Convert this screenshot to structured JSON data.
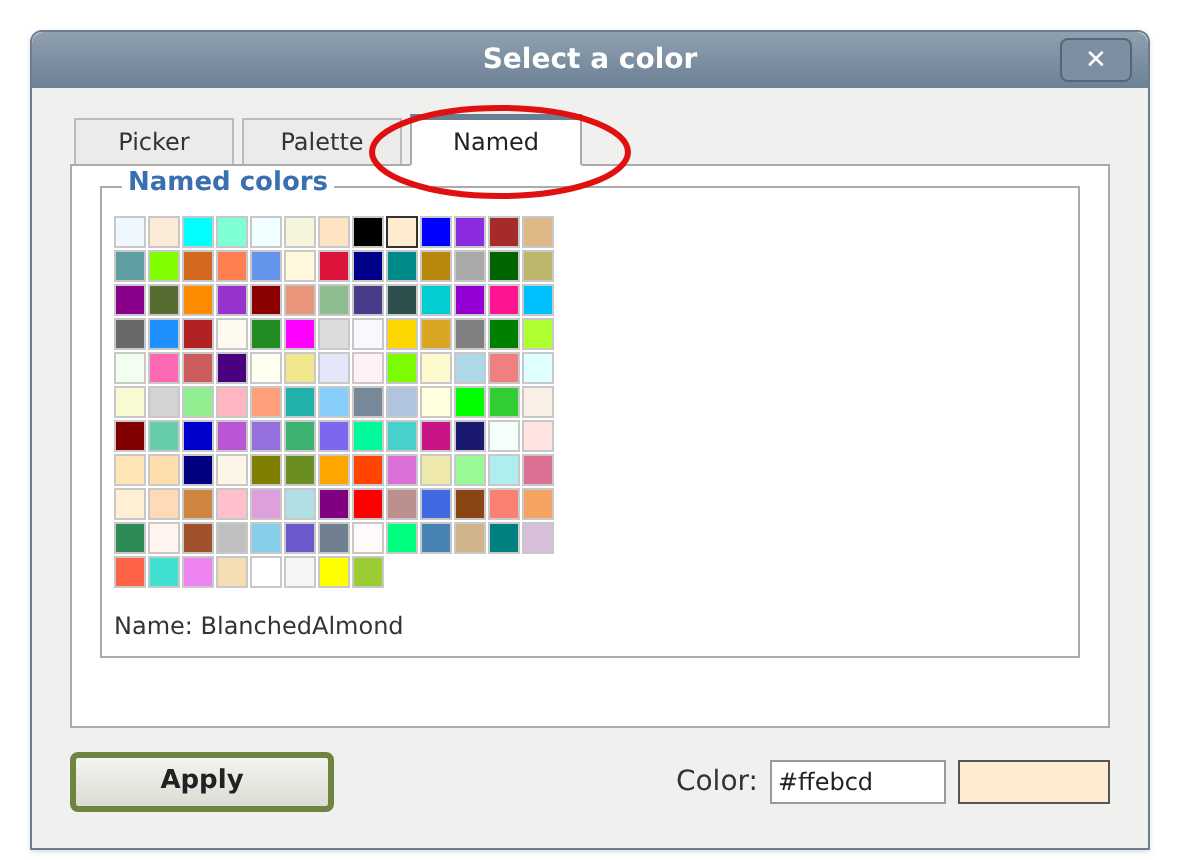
{
  "window": {
    "title": "Select a color",
    "close_label": "✕"
  },
  "tabs": [
    {
      "label": "Picker",
      "selected": false
    },
    {
      "label": "Palette",
      "selected": false
    },
    {
      "label": "Named",
      "selected": true
    }
  ],
  "group": {
    "title": "Named colors"
  },
  "swatch_rows": [
    [
      {
        "color": "#f0f8ff",
        "selected": false
      },
      {
        "color": "#faebd7",
        "selected": false
      },
      {
        "color": "#00ffff",
        "selected": false
      },
      {
        "color": "#7fffd4",
        "selected": false
      },
      {
        "color": "#f0ffff",
        "selected": false
      },
      {
        "color": "#f5f5dc",
        "selected": false
      },
      {
        "color": "#ffe4c4",
        "selected": false
      },
      {
        "color": "#000000",
        "selected": false
      },
      {
        "color": "#ffebcd",
        "selected": true
      },
      {
        "color": "#0000ff",
        "selected": false
      },
      {
        "color": "#8a2be2",
        "selected": false
      },
      {
        "color": "#a52a2a",
        "selected": false
      },
      {
        "color": "#deb887",
        "selected": false
      }
    ],
    [
      {
        "color": "#5f9ea0",
        "selected": false
      },
      {
        "color": "#7fff00",
        "selected": false
      },
      {
        "color": "#d2691e",
        "selected": false
      },
      {
        "color": "#ff7f50",
        "selected": false
      },
      {
        "color": "#6495ed",
        "selected": false
      },
      {
        "color": "#fff8dc",
        "selected": false
      },
      {
        "color": "#dc143c",
        "selected": false
      },
      {
        "color": "#00008b",
        "selected": false
      },
      {
        "color": "#008b8b",
        "selected": false
      },
      {
        "color": "#b8860b",
        "selected": false
      },
      {
        "color": "#a9a9a9",
        "selected": false
      },
      {
        "color": "#006400",
        "selected": false
      },
      {
        "color": "#bdb76b",
        "selected": false
      }
    ],
    [
      {
        "color": "#8b008b",
        "selected": false
      },
      {
        "color": "#556b2f",
        "selected": false
      },
      {
        "color": "#ff8c00",
        "selected": false
      },
      {
        "color": "#9932cc",
        "selected": false
      },
      {
        "color": "#8b0000",
        "selected": false
      },
      {
        "color": "#e9967a",
        "selected": false
      },
      {
        "color": "#8fbc8f",
        "selected": false
      },
      {
        "color": "#483d8b",
        "selected": false
      },
      {
        "color": "#2f4f4f",
        "selected": false
      },
      {
        "color": "#00ced1",
        "selected": false
      },
      {
        "color": "#9400d3",
        "selected": false
      },
      {
        "color": "#ff1493",
        "selected": false
      },
      {
        "color": "#00bfff",
        "selected": false
      }
    ],
    [
      {
        "color": "#696969",
        "selected": false
      },
      {
        "color": "#1e90ff",
        "selected": false
      },
      {
        "color": "#b22222",
        "selected": false
      },
      {
        "color": "#fffaf0",
        "selected": false
      },
      {
        "color": "#228b22",
        "selected": false
      },
      {
        "color": "#ff00ff",
        "selected": false
      },
      {
        "color": "#dcdcdc",
        "selected": false
      },
      {
        "color": "#f8f8ff",
        "selected": false
      },
      {
        "color": "#ffd700",
        "selected": false
      },
      {
        "color": "#daa520",
        "selected": false
      },
      {
        "color": "#808080",
        "selected": false
      },
      {
        "color": "#008000",
        "selected": false
      },
      {
        "color": "#adff2f",
        "selected": false
      }
    ],
    [
      {
        "color": "#f0fff0",
        "selected": false
      },
      {
        "color": "#ff69b4",
        "selected": false
      },
      {
        "color": "#cd5c5c",
        "selected": false
      },
      {
        "color": "#4b0082",
        "selected": false
      },
      {
        "color": "#fffff0",
        "selected": false
      },
      {
        "color": "#f0e68c",
        "selected": false
      },
      {
        "color": "#e6e6fa",
        "selected": false
      },
      {
        "color": "#fff0f5",
        "selected": false
      },
      {
        "color": "#7cfc00",
        "selected": false
      },
      {
        "color": "#fffacd",
        "selected": false
      },
      {
        "color": "#add8e6",
        "selected": false
      },
      {
        "color": "#f08080",
        "selected": false
      },
      {
        "color": "#e0ffff",
        "selected": false
      }
    ],
    [
      {
        "color": "#fafad2",
        "selected": false
      },
      {
        "color": "#d3d3d3",
        "selected": false
      },
      {
        "color": "#90ee90",
        "selected": false
      },
      {
        "color": "#ffb6c1",
        "selected": false
      },
      {
        "color": "#ffa07a",
        "selected": false
      },
      {
        "color": "#20b2aa",
        "selected": false
      },
      {
        "color": "#87cefa",
        "selected": false
      },
      {
        "color": "#778899",
        "selected": false
      },
      {
        "color": "#b0c4de",
        "selected": false
      },
      {
        "color": "#ffffe0",
        "selected": false
      },
      {
        "color": "#00ff00",
        "selected": false
      },
      {
        "color": "#32cd32",
        "selected": false
      },
      {
        "color": "#faf0e6",
        "selected": false
      }
    ],
    [
      {
        "color": "#800000",
        "selected": false
      },
      {
        "color": "#66cdaa",
        "selected": false
      },
      {
        "color": "#0000cd",
        "selected": false
      },
      {
        "color": "#ba55d3",
        "selected": false
      },
      {
        "color": "#9370db",
        "selected": false
      },
      {
        "color": "#3cb371",
        "selected": false
      },
      {
        "color": "#7b68ee",
        "selected": false
      },
      {
        "color": "#00fa9a",
        "selected": false
      },
      {
        "color": "#48d1cc",
        "selected": false
      },
      {
        "color": "#c71585",
        "selected": false
      },
      {
        "color": "#191970",
        "selected": false
      },
      {
        "color": "#f5fffa",
        "selected": false
      },
      {
        "color": "#ffe4e1",
        "selected": false
      }
    ],
    [
      {
        "color": "#ffe4b5",
        "selected": false
      },
      {
        "color": "#ffdead",
        "selected": false
      },
      {
        "color": "#000080",
        "selected": false
      },
      {
        "color": "#fdf5e6",
        "selected": false
      },
      {
        "color": "#808000",
        "selected": false
      },
      {
        "color": "#6b8e23",
        "selected": false
      },
      {
        "color": "#ffa500",
        "selected": false
      },
      {
        "color": "#ff4500",
        "selected": false
      },
      {
        "color": "#da70d6",
        "selected": false
      },
      {
        "color": "#eee8aa",
        "selected": false
      },
      {
        "color": "#98fb98",
        "selected": false
      },
      {
        "color": "#afeeee",
        "selected": false
      },
      {
        "color": "#db7093",
        "selected": false
      }
    ],
    [
      {
        "color": "#ffefd5",
        "selected": false
      },
      {
        "color": "#ffdab9",
        "selected": false
      },
      {
        "color": "#cd853f",
        "selected": false
      },
      {
        "color": "#ffc0cb",
        "selected": false
      },
      {
        "color": "#dda0dd",
        "selected": false
      },
      {
        "color": "#b0e0e6",
        "selected": false
      },
      {
        "color": "#800080",
        "selected": false
      },
      {
        "color": "#ff0000",
        "selected": false
      },
      {
        "color": "#bc8f8f",
        "selected": false
      },
      {
        "color": "#4169e1",
        "selected": false
      },
      {
        "color": "#8b4513",
        "selected": false
      },
      {
        "color": "#fa8072",
        "selected": false
      },
      {
        "color": "#f4a460",
        "selected": false
      }
    ],
    [
      {
        "color": "#2e8b57",
        "selected": false
      },
      {
        "color": "#fff5ee",
        "selected": false
      },
      {
        "color": "#a0522d",
        "selected": false
      },
      {
        "color": "#c0c0c0",
        "selected": false
      },
      {
        "color": "#87ceeb",
        "selected": false
      },
      {
        "color": "#6a5acd",
        "selected": false
      },
      {
        "color": "#708090",
        "selected": false
      },
      {
        "color": "#fffafa",
        "selected": false
      },
      {
        "color": "#00ff7f",
        "selected": false
      },
      {
        "color": "#4682b4",
        "selected": false
      },
      {
        "color": "#d2b48c",
        "selected": false
      },
      {
        "color": "#008080",
        "selected": false
      },
      {
        "color": "#d8bfd8",
        "selected": false
      }
    ],
    [
      {
        "color": "#ff6347",
        "selected": false
      },
      {
        "color": "#40e0d0",
        "selected": false
      },
      {
        "color": "#ee82ee",
        "selected": false
      },
      {
        "color": "#f5deb3",
        "selected": false
      },
      {
        "color": "#ffffff",
        "selected": false
      },
      {
        "color": "#f5f5f5",
        "selected": false
      },
      {
        "color": "#ffff00",
        "selected": false
      },
      {
        "color": "#9acd32",
        "selected": false
      }
    ]
  ],
  "name_line": "Name: BlanchedAlmond",
  "apply_button": "Apply",
  "color_field": {
    "label": "Color:",
    "value": "#ffebcd"
  }
}
